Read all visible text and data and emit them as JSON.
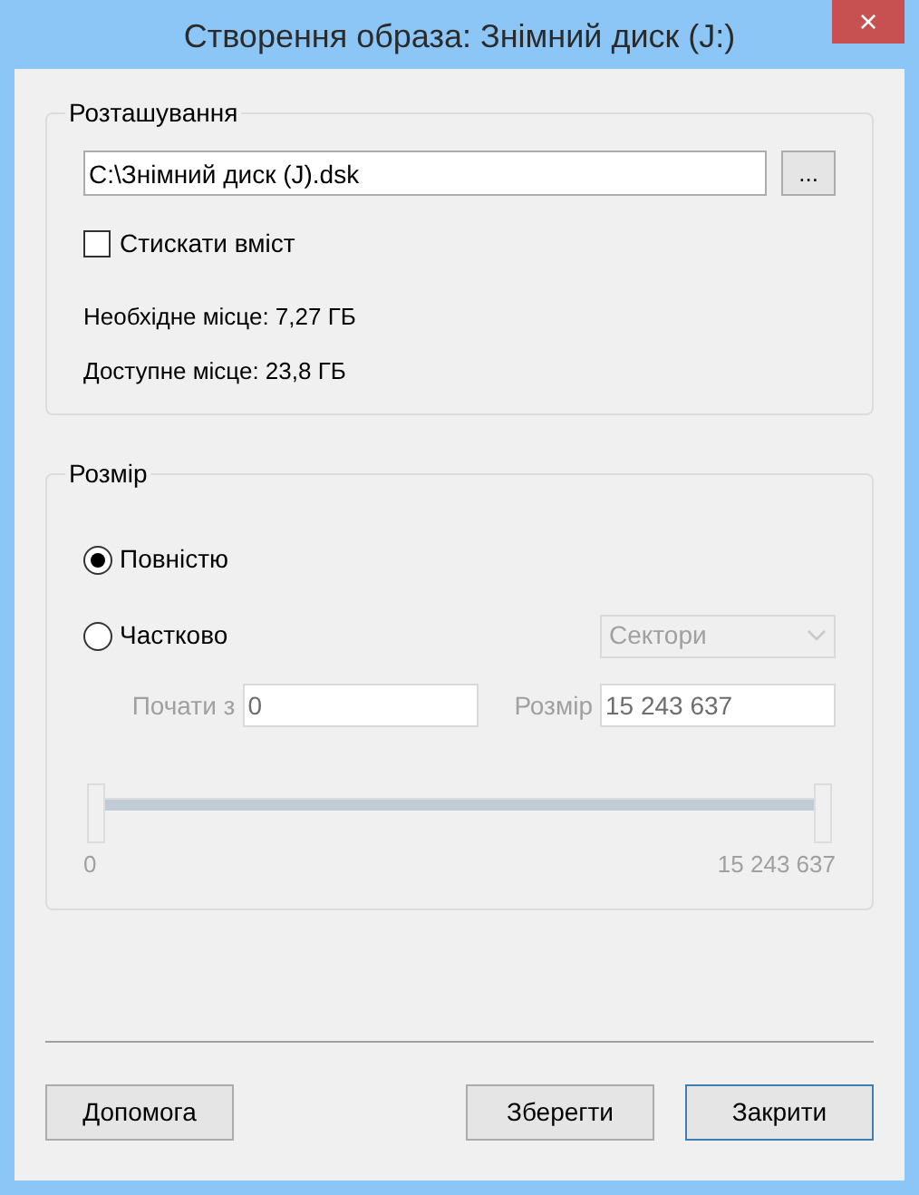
{
  "window": {
    "title": "Створення образа: Знімний диск (J:)",
    "close": "×"
  },
  "location": {
    "title": "Розташування",
    "path": "C:\\Знімний диск (J).dsk",
    "browse": "...",
    "compress": {
      "label": "Стискати вміст",
      "checked": false
    },
    "required": "Необхідне місце: 7,27 ГБ",
    "available": "Доступне місце: 23,8 ГБ"
  },
  "size": {
    "title": "Розмір",
    "options": [
      {
        "label": "Повністю",
        "selected": true
      },
      {
        "label": "Частково",
        "selected": false
      }
    ],
    "unit": "Сектори",
    "disabled": true,
    "start_label": "Почати з",
    "start": "0",
    "size_label": "Розмір",
    "size_value": "15 243 637",
    "range": {
      "level": 1,
      "min": "0",
      "max": "15 243 637"
    }
  },
  "buttons": [
    {
      "label": "Допомога",
      "default": false
    },
    {
      "label": "Зберегти",
      "default": false
    },
    {
      "label": "Закрити",
      "default": true
    }
  ]
}
